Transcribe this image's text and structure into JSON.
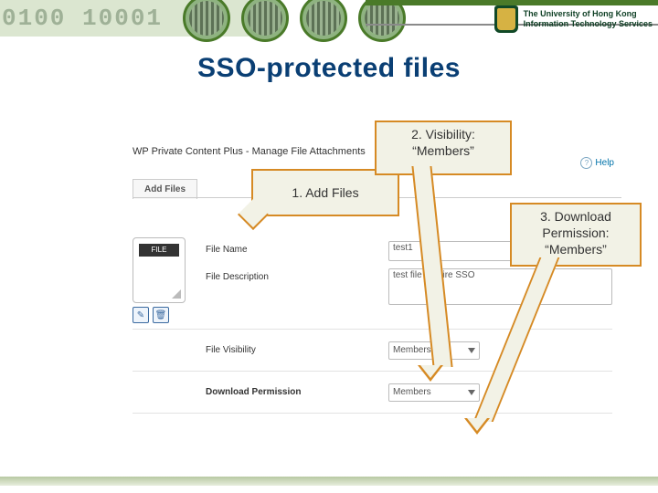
{
  "banner": {
    "binary": "0100     10001",
    "org_line1": "The University of Hong Kong",
    "org_line2": "Information Technology Services"
  },
  "title": "SSO-protected files",
  "callouts": {
    "c1": "1. Add Files",
    "c2_l1": "2. Visibility:",
    "c2_l2": "“Members”",
    "c3_l1": "3. Download",
    "c3_l2": "Permission:",
    "c3_l3": "“Members”"
  },
  "wp": {
    "panel_title": "WP Private Content Plus - Manage File Attachments",
    "help": "Help",
    "tab": "Add Files",
    "file_tag": "FILE",
    "lbl_name": "File Name",
    "lbl_desc": "File Description",
    "lbl_vis": "File Visibility",
    "lbl_perm": "Download Permission",
    "val_name": "test1",
    "val_desc": "test file require SSO",
    "val_vis": "Members",
    "val_perm": "Members"
  }
}
